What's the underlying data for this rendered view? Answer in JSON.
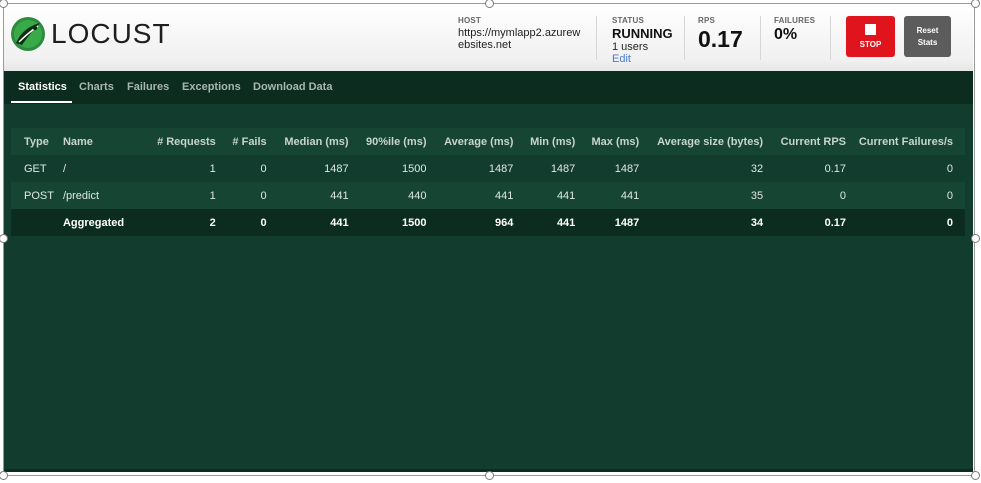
{
  "header": {
    "logo_text": "LOCUST",
    "host": {
      "label": "HOST",
      "value": "https://mymlapp2.azurewebsites.net"
    },
    "status": {
      "label": "STATUS",
      "value": "RUNNING",
      "users": "1 users",
      "edit_label": "Edit"
    },
    "rps": {
      "label": "RPS",
      "value": "0.17"
    },
    "failures": {
      "label": "FAILURES",
      "value": "0%"
    },
    "stop_label": "STOP",
    "reset_label_line1": "Reset",
    "reset_label_line2": "Stats"
  },
  "tabs": [
    {
      "label": "Statistics",
      "active": true
    },
    {
      "label": "Charts",
      "active": false
    },
    {
      "label": "Failures",
      "active": false
    },
    {
      "label": "Exceptions",
      "active": false
    },
    {
      "label": "Download Data",
      "active": false
    }
  ],
  "table": {
    "columns": [
      "Type",
      "Name",
      "# Requests",
      "# Fails",
      "Median (ms)",
      "90%ile (ms)",
      "Average (ms)",
      "Min (ms)",
      "Max (ms)",
      "Average size (bytes)",
      "Current RPS",
      "Current Failures/s"
    ],
    "rows": [
      [
        "GET",
        "/",
        "1",
        "0",
        "1487",
        "1500",
        "1487",
        "1487",
        "1487",
        "32",
        "0.17",
        "0"
      ],
      [
        "POST",
        "/predict",
        "1",
        "0",
        "441",
        "440",
        "441",
        "441",
        "441",
        "35",
        "0",
        "0"
      ]
    ],
    "total": [
      "",
      "Aggregated",
      "2",
      "0",
      "441",
      "1500",
      "964",
      "441",
      "1487",
      "34",
      "0.17",
      "0"
    ]
  },
  "colors": {
    "background": "#123d2e",
    "dark_band": "#0c2c20",
    "stop_button": "#e0141c",
    "reset_button": "#5c5c5c",
    "edit_link": "#4a7bd0"
  }
}
